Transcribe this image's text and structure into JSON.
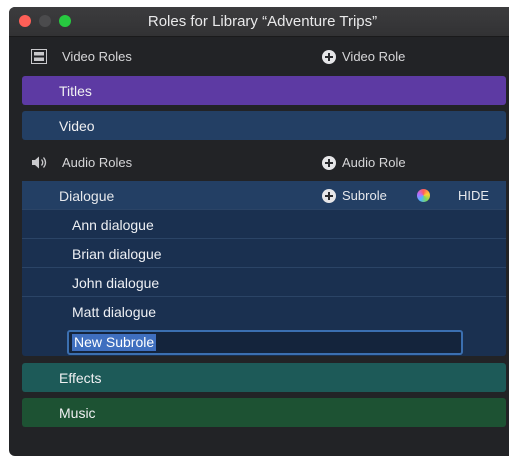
{
  "window": {
    "title": "Roles for Library “Adventure Trips”"
  },
  "video_section": {
    "label": "Video Roles",
    "add_label": "Video Role"
  },
  "video_roles": [
    {
      "label": "Titles",
      "color": "#5d3aa3"
    },
    {
      "label": "Video",
      "color": "#233f64"
    }
  ],
  "audio_section": {
    "label": "Audio Roles",
    "add_label": "Audio Role"
  },
  "dialogue": {
    "label": "Dialogue",
    "add_label": "Subrole",
    "hide_label": "HIDE",
    "subroles": [
      "Ann dialogue",
      "Brian dialogue",
      "John dialogue",
      "Matt dialogue"
    ],
    "new_subrole_value": "New Subrole"
  },
  "audio_roles": [
    {
      "label": "Effects",
      "color": "#1d5a58"
    },
    {
      "label": "Music",
      "color": "#1d5233"
    }
  ]
}
